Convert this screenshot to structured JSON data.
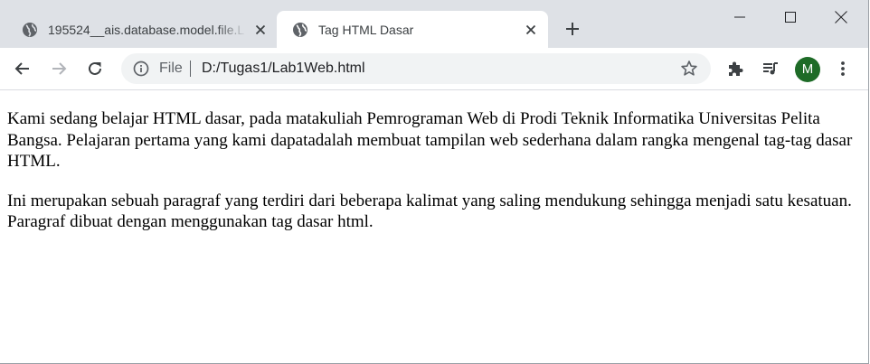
{
  "tabs": [
    {
      "title": "195524__ais.database.model.file.L",
      "icon": "globe-icon",
      "active": false
    },
    {
      "title": "Tag HTML Dasar",
      "icon": "globe-icon",
      "active": true
    }
  ],
  "toolbar": {
    "scheme_label": "File",
    "url": "D:/Tugas1/Lab1Web.html",
    "avatar_initial": "M",
    "avatar_color": "#1e6b27"
  },
  "page": {
    "paragraphs": [
      "Kami sedang belajar HTML dasar, pada matakuliah Pemrograman Web di Prodi Teknik Informatika Universitas Pelita Bangsa. Pelajaran pertama yang kami dapatadalah membuat tampilan web sederhana dalam rangka mengenal tag-tag dasar HTML.",
      "Ini merupakan sebuah paragraf yang terdiri dari beberapa kalimat yang saling mendukung sehingga menjadi satu kesatuan. Paragraf dibuat dengan menggunakan tag dasar html."
    ]
  }
}
